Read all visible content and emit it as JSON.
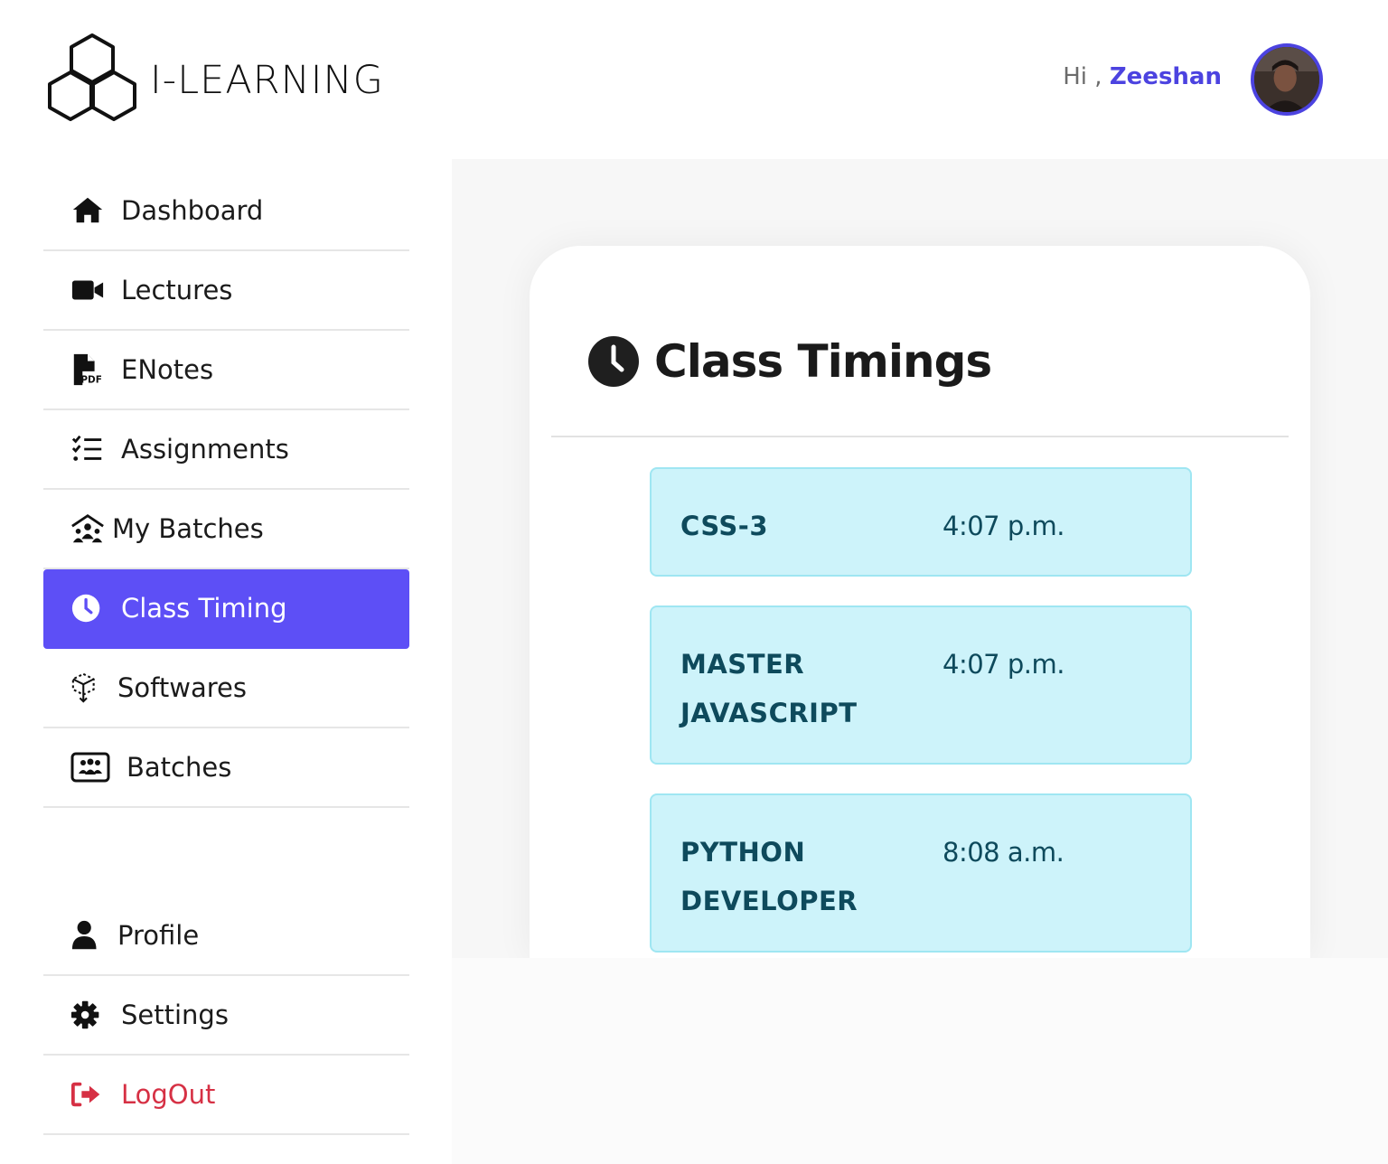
{
  "brand": {
    "name": "I-LEARNING"
  },
  "header": {
    "greeting_prefix": "Hi ,",
    "user_name": "Zeeshan"
  },
  "sidebar": {
    "items": [
      {
        "label": "Dashboard",
        "icon": "home-icon"
      },
      {
        "label": "Lectures",
        "icon": "video-icon"
      },
      {
        "label": "ENotes",
        "icon": "pdf-icon"
      },
      {
        "label": "Assignments",
        "icon": "checklist-icon"
      },
      {
        "label": "My Batches",
        "icon": "people-roof-icon"
      },
      {
        "label": "Class Timing",
        "icon": "clock-icon",
        "active": true
      },
      {
        "label": "Softwares",
        "icon": "cube-icon"
      },
      {
        "label": "Batches",
        "icon": "rectangle-group-icon"
      }
    ],
    "bottom_items": [
      {
        "label": "Profile",
        "icon": "user-icon"
      },
      {
        "label": "Settings",
        "icon": "gear-icon"
      },
      {
        "label": "LogOut",
        "icon": "logout-icon"
      }
    ]
  },
  "main": {
    "title": "Class Timings",
    "timings": [
      {
        "course": "CSS-3",
        "time": "4:07 p.m."
      },
      {
        "course": "MASTER JAVASCRIPT",
        "time": "4:07 p.m."
      },
      {
        "course": "PYTHON DEVELOPER",
        "time": "8:08 a.m."
      }
    ]
  },
  "colors": {
    "accent": "#5d4ff6",
    "user_name": "#4c43e0",
    "logout": "#d63044",
    "timing_card_bg": "#cdf3fa",
    "timing_text": "#0e4a5c"
  }
}
